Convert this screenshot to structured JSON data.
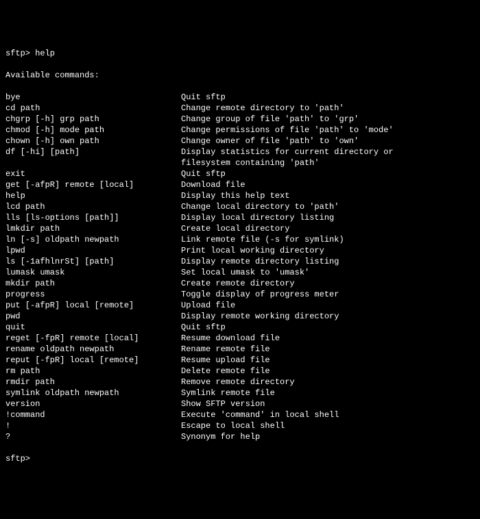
{
  "terminal": {
    "prompt_line": "sftp> help",
    "heading": "Available commands:",
    "final_prompt": "sftp>",
    "commands": [
      {
        "cmd": "bye",
        "desc": "Quit sftp"
      },
      {
        "cmd": "cd path",
        "desc": "Change remote directory to 'path'"
      },
      {
        "cmd": "chgrp [-h] grp path",
        "desc": "Change group of file 'path' to 'grp'"
      },
      {
        "cmd": "chmod [-h] mode path",
        "desc": "Change permissions of file 'path' to 'mode'"
      },
      {
        "cmd": "chown [-h] own path",
        "desc": "Change owner of file 'path' to 'own'"
      },
      {
        "cmd": "df [-hi] [path]",
        "desc": "Display statistics for current directory or"
      },
      {
        "cmd": "",
        "desc": "filesystem containing 'path'"
      },
      {
        "cmd": "exit",
        "desc": "Quit sftp"
      },
      {
        "cmd": "get [-afpR] remote [local]",
        "desc": "Download file"
      },
      {
        "cmd": "help",
        "desc": "Display this help text"
      },
      {
        "cmd": "lcd path",
        "desc": "Change local directory to 'path'"
      },
      {
        "cmd": "lls [ls-options [path]]",
        "desc": "Display local directory listing"
      },
      {
        "cmd": "lmkdir path",
        "desc": "Create local directory"
      },
      {
        "cmd": "ln [-s] oldpath newpath",
        "desc": "Link remote file (-s for symlink)"
      },
      {
        "cmd": "lpwd",
        "desc": "Print local working directory"
      },
      {
        "cmd": "ls [-1afhlnrSt] [path]",
        "desc": "Display remote directory listing"
      },
      {
        "cmd": "lumask umask",
        "desc": "Set local umask to 'umask'"
      },
      {
        "cmd": "mkdir path",
        "desc": "Create remote directory"
      },
      {
        "cmd": "progress",
        "desc": "Toggle display of progress meter"
      },
      {
        "cmd": "put [-afpR] local [remote]",
        "desc": "Upload file"
      },
      {
        "cmd": "pwd",
        "desc": "Display remote working directory"
      },
      {
        "cmd": "quit",
        "desc": "Quit sftp"
      },
      {
        "cmd": "reget [-fpR] remote [local]",
        "desc": "Resume download file"
      },
      {
        "cmd": "rename oldpath newpath",
        "desc": "Rename remote file"
      },
      {
        "cmd": "reput [-fpR] local [remote]",
        "desc": "Resume upload file"
      },
      {
        "cmd": "rm path",
        "desc": "Delete remote file"
      },
      {
        "cmd": "rmdir path",
        "desc": "Remove remote directory"
      },
      {
        "cmd": "symlink oldpath newpath",
        "desc": "Symlink remote file"
      },
      {
        "cmd": "version",
        "desc": "Show SFTP version"
      },
      {
        "cmd": "!command",
        "desc": "Execute 'command' in local shell"
      },
      {
        "cmd": "!",
        "desc": "Escape to local shell"
      },
      {
        "cmd": "?",
        "desc": "Synonym for help"
      }
    ]
  }
}
